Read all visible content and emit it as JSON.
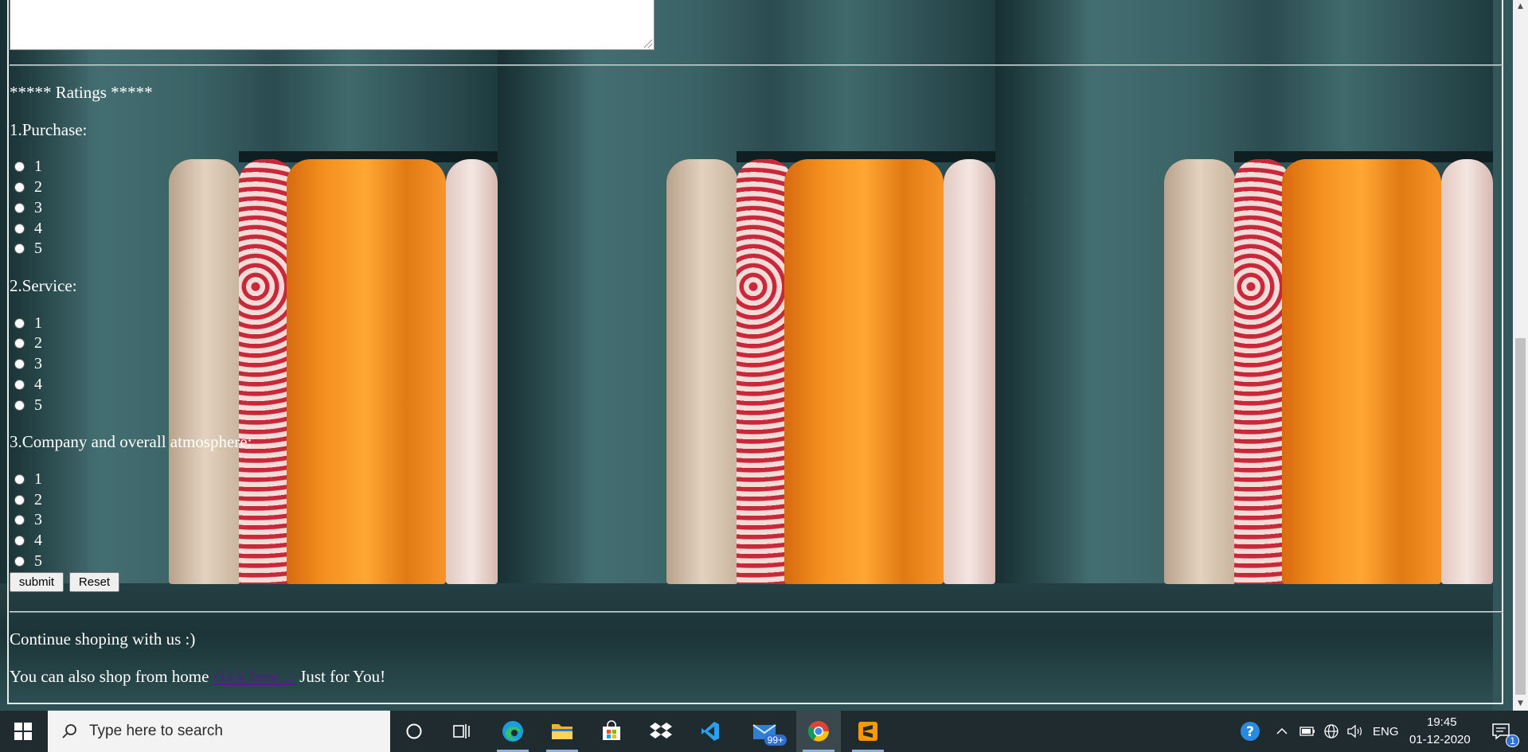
{
  "form": {
    "ratings_heading": "***** Ratings *****",
    "questions": [
      {
        "label": "1.Purchase:",
        "options": [
          "1",
          "2",
          "3",
          "4",
          "5"
        ]
      },
      {
        "label": "2.Service:",
        "options": [
          "1",
          "2",
          "3",
          "4",
          "5"
        ]
      },
      {
        "label": "3.Company and overall atmosphere:",
        "options": [
          "1",
          "2",
          "3",
          "4",
          "5"
        ]
      }
    ],
    "submit_label": "submit",
    "reset_label": "Reset"
  },
  "footer": {
    "continue_text": "Continue shoping with us :)",
    "home_prefix": "You can also shop from home ",
    "link_text": "click here....",
    "home_suffix": " Just for You!"
  },
  "taskbar": {
    "search_placeholder": "Type here to search",
    "mail_badge": "99+",
    "language": "ENG",
    "time": "19:45",
    "date": "01-12-2020",
    "notification_count": "1"
  }
}
